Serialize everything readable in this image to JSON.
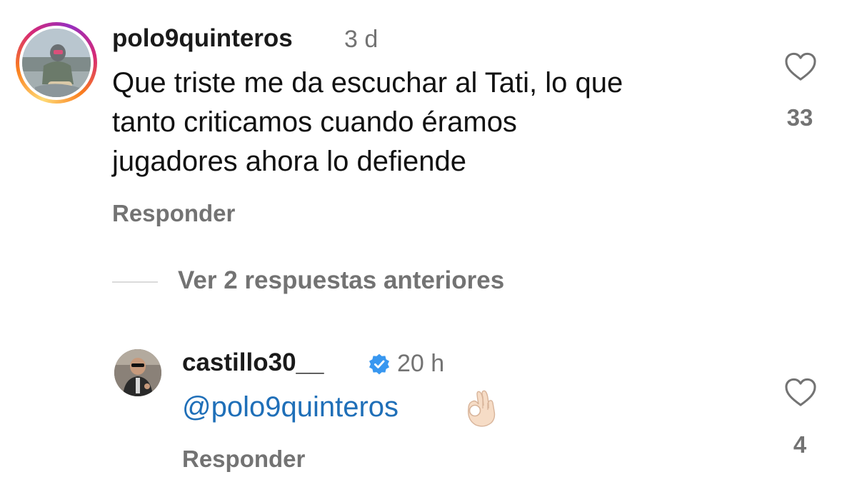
{
  "comments": [
    {
      "username": "polo9quinteros",
      "time": "3 d",
      "text_lines": [
        "Que triste me da escuchar al Tati, lo que",
        "tanto criticamos cuando éramos",
        "jugadores ahora lo defiende"
      ],
      "reply_label": "Responder",
      "like_count": "33",
      "story_ring": true
    },
    {
      "username": "castillo30__",
      "verified": true,
      "time": "20 h",
      "mention": "@polo9quinteros",
      "emoji": "ok-hand-emoji",
      "reply_label": "Responder",
      "like_count": "4"
    }
  ],
  "view_replies_label": "Ver 2 respuestas anteriores",
  "icons": {
    "like": "heart-outline-icon",
    "verified": "verified-badge-icon"
  },
  "colors": {
    "text": "#111111",
    "muted": "#737373",
    "mention": "#1f6fb8",
    "verified": "#3897f0"
  }
}
